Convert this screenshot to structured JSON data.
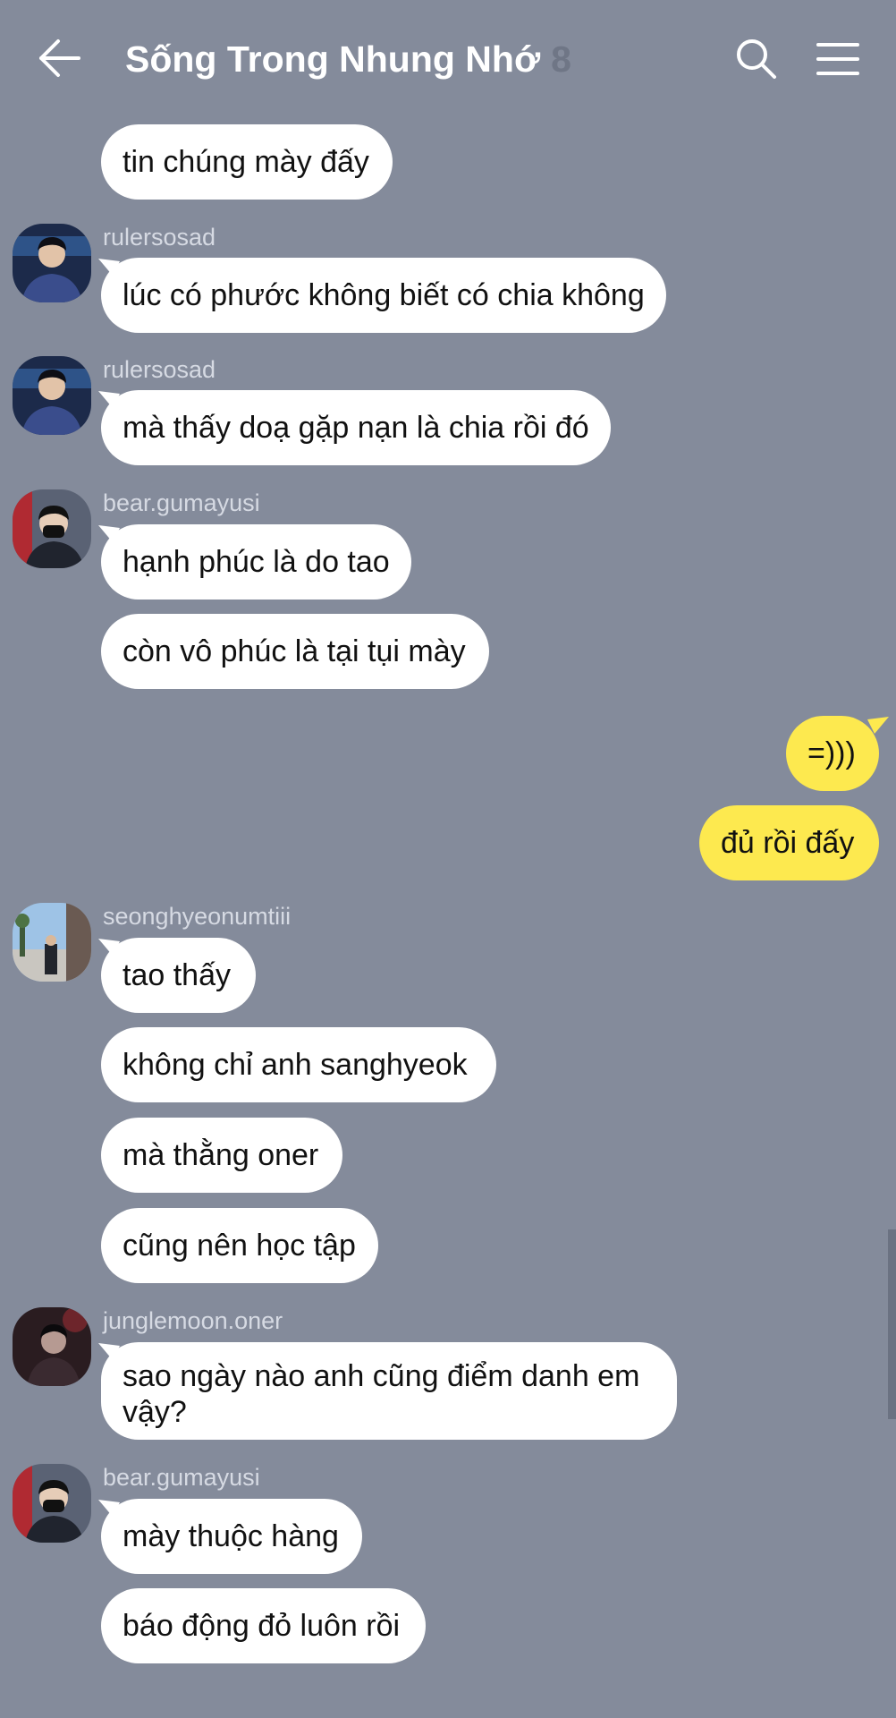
{
  "header": {
    "title": "Sống Trong Nhung Nhớ",
    "member_count": "8",
    "icons": {
      "back": "arrow-left-icon",
      "search": "search-icon",
      "menu": "hamburger-menu-icon"
    }
  },
  "colors": {
    "background": "#848b9b",
    "incoming_bubble": "#ffffff",
    "outgoing_bubble": "#fde94f",
    "sender_name": "#d6dae3"
  },
  "messages": [
    {
      "text": "tin chúng mày đấy"
    },
    {
      "sender": "rulersosad",
      "text": "lúc có phước không biết có chia không"
    },
    {
      "sender": "rulersosad",
      "text": "mà thấy doạ gặp nạn là chia rồi đó"
    },
    {
      "sender": "bear.gumayusi",
      "text": "hạnh phúc là do tao"
    },
    {
      "text": "còn vô phúc là tại tụi mày"
    },
    {
      "text": "=)))",
      "mine": true
    },
    {
      "text": "đủ rồi đấy",
      "mine": true
    },
    {
      "sender": "seonghyeonumtiii",
      "text": "tao thấy"
    },
    {
      "text": "không chỉ anh sanghyeok"
    },
    {
      "text": "mà thằng oner"
    },
    {
      "text": "cũng nên học tập"
    },
    {
      "sender": "junglemoon.oner",
      "text": "sao ngày nào anh cũng điểm danh em vậy?"
    },
    {
      "sender": "bear.gumayusi",
      "text": "mày thuộc hàng"
    },
    {
      "text": "báo động đỏ luôn rồi"
    }
  ]
}
